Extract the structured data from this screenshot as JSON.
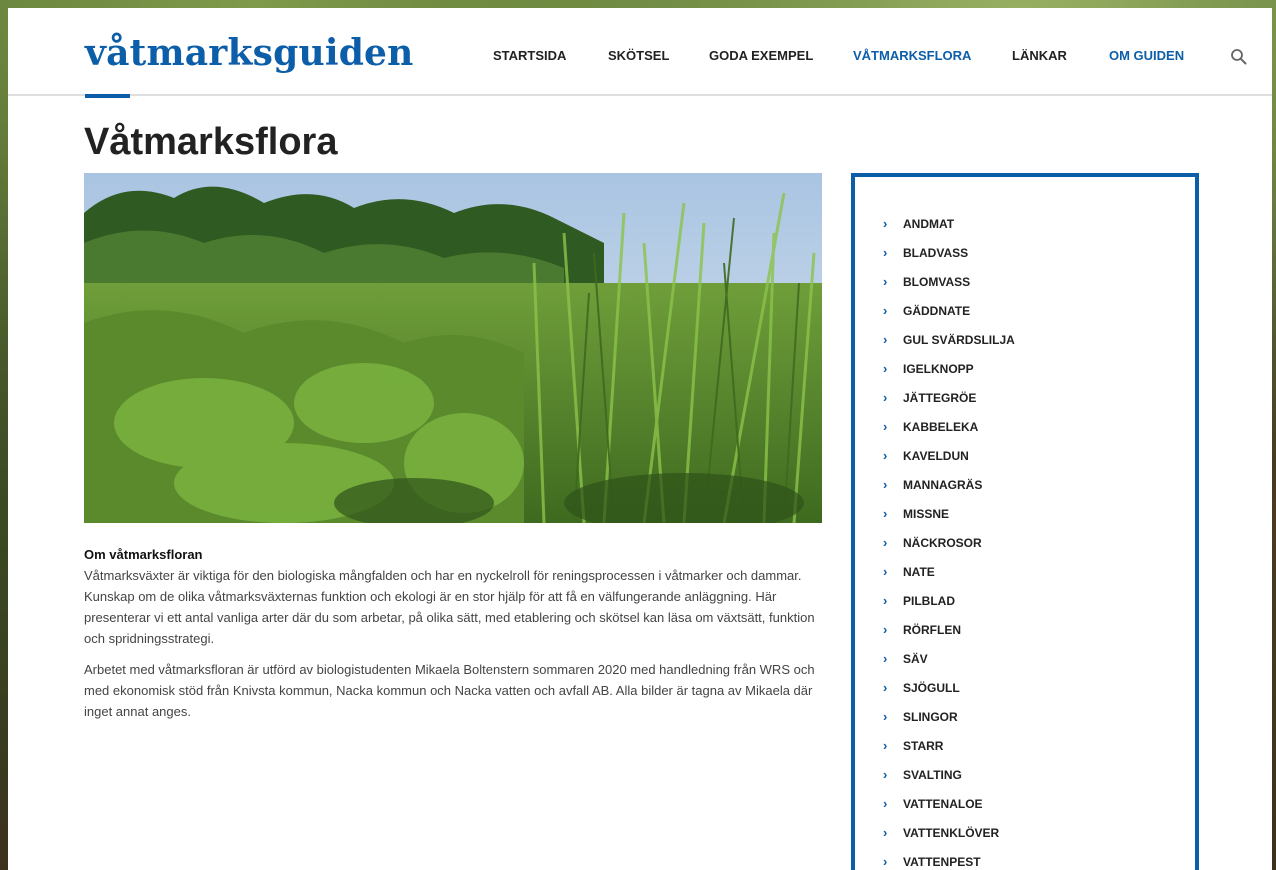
{
  "header": {
    "logo": "våtmarksguiden",
    "nav": [
      {
        "label": "STARTSIDA",
        "active": false
      },
      {
        "label": "SKÖTSEL",
        "active": false
      },
      {
        "label": "GODA EXEMPEL",
        "active": false
      },
      {
        "label": "VÅTMARKSFLORA",
        "active": true
      },
      {
        "label": "LÄNKAR",
        "active": false
      },
      {
        "label": "OM GUIDEN",
        "active": true
      }
    ],
    "search_icon": "search-icon"
  },
  "page": {
    "title": "Våtmarksflora"
  },
  "content": {
    "subhead": "Om våtmarksfloran",
    "paragraph1": "Våtmarksväxter är viktiga för den biologiska mångfalden och har en nyckelroll för reningsprocessen i våtmarker och dammar. Kunskap om de olika våtmarksväxternas funktion och ekologi är en stor hjälp för att få en välfungerande anläggning. Här presenterar vi ett antal vanliga arter där du som arbetar, på olika sätt, med etablering och skötsel kan läsa om växtsätt, funktion och spridningsstrategi.",
    "paragraph2": "Arbetet med våtmarksfloran är utförd av biologistudenten Mikaela Boltenstern sommaren 2020 med handledning från WRS och med ekonomisk stöd från Knivsta kommun, Nacka kommun och Nacka vatten och avfall AB. Alla bilder är tagna av Mikaela där inget annat anges."
  },
  "sidebar": {
    "items": [
      "ANDMAT",
      "BLADVASS",
      "BLOMVASS",
      "GÄDDNATE",
      "GUL SVÄRDSLILJA",
      "IGELKNOPP",
      "JÄTTEGRÖE",
      "KABBELEKA",
      "KAVELDUN",
      "MANNAGRÄS",
      "MISSNE",
      "NÄCKROSOR",
      "NATE",
      "PILBLAD",
      "RÖRFLEN",
      "SÄV",
      "SJÖGULL",
      "SLINGOR",
      "STARR",
      "SVALTING",
      "VATTENALOE",
      "VATTENKLÖVER",
      "VATTENPEST"
    ]
  },
  "colors": {
    "brand": "#0d5ea8",
    "text": "#222222",
    "body_text": "#444444"
  }
}
